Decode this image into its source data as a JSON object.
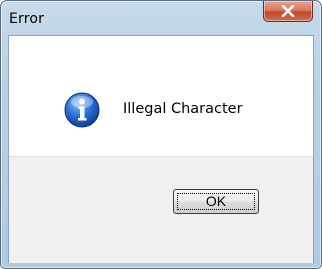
{
  "dialog": {
    "title": "Error",
    "message": "Illegal Character",
    "ok_label": "OK",
    "icon": "info-icon",
    "close_icon": "close-icon"
  }
}
